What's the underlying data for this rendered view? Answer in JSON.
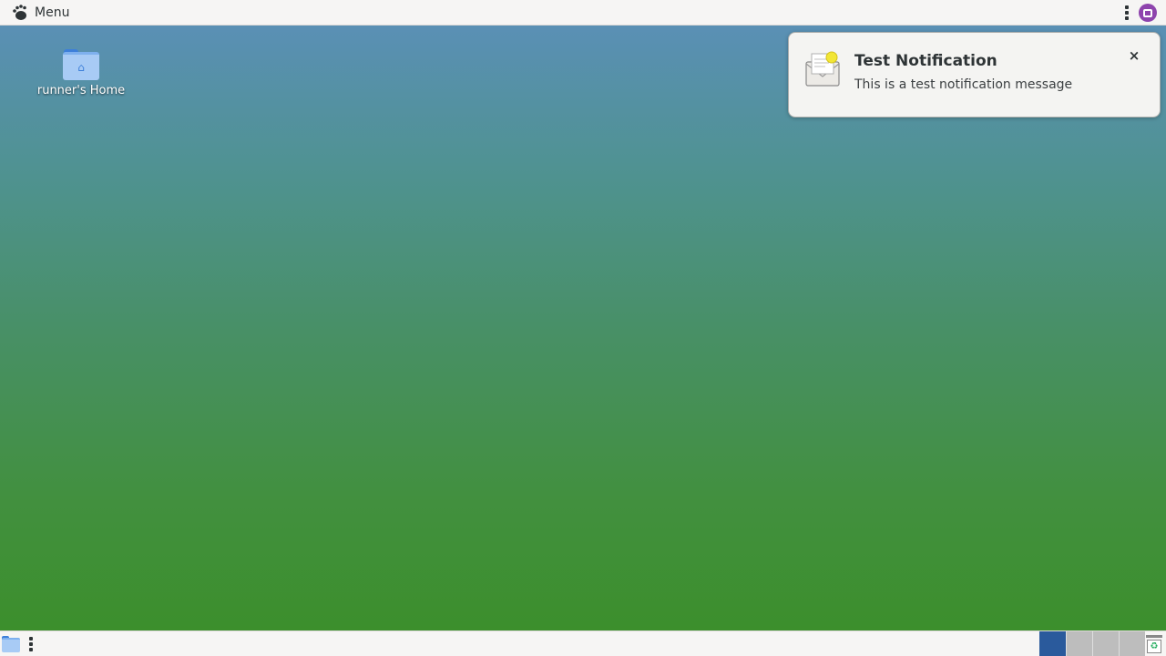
{
  "top_panel": {
    "menu_label": "Menu",
    "menu_icon": "gnome-foot-icon",
    "overflow_icon": "kebab-menu-icon",
    "tray_icon": "app-indicator-icon"
  },
  "desktop": {
    "icons": [
      {
        "label": "runner's Home",
        "icon": "home-folder-icon"
      }
    ]
  },
  "notification": {
    "title": "Test Notification",
    "body": "This is a test notification message",
    "icon": "mail-notification-icon",
    "close_glyph": "×"
  },
  "bottom_panel": {
    "show_desktop_icon": "folder-icon",
    "workspaces": [
      {
        "index": 1,
        "active": true
      },
      {
        "index": 2,
        "active": false
      },
      {
        "index": 3,
        "active": false
      },
      {
        "index": 4,
        "active": false
      }
    ],
    "trash_icon": "trash-icon"
  },
  "colors": {
    "panel": "#f6f5f4",
    "active_workspace": "#2a5a9c",
    "inactive_workspace": "#bdbdbd",
    "desktop_top": "#5a90b5",
    "desktop_bottom": "#3c8f2c"
  }
}
